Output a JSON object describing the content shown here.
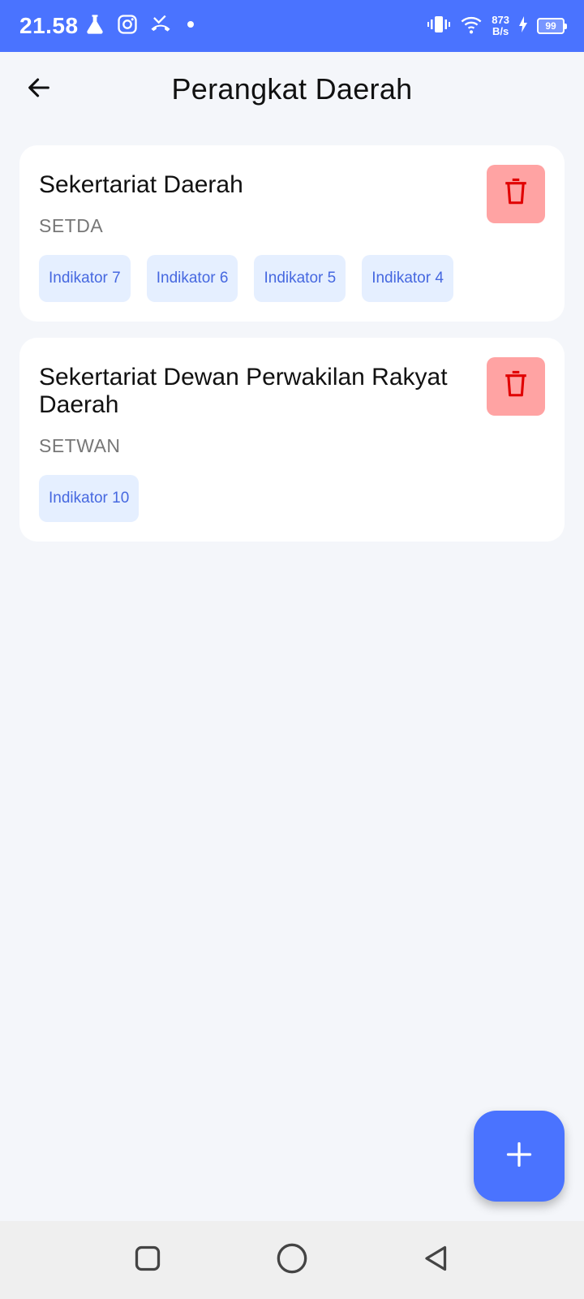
{
  "status_bar": {
    "time": "21.58",
    "net_speed_value": "873",
    "net_speed_unit": "B/s",
    "battery": "99",
    "icons": [
      "flask-icon",
      "instagram-icon",
      "missed-call-icon",
      "dot-icon",
      "vibrate-icon",
      "wifi-icon",
      "charging-icon",
      "battery-icon"
    ]
  },
  "app_bar": {
    "title": "Perangkat Daerah",
    "back_icon": "arrow-left-icon"
  },
  "items": [
    {
      "name": "Sekertariat Daerah",
      "code": "SETDA",
      "indicators": [
        "Indikator 7",
        "Indikator 6",
        "Indikator 5",
        "Indikator 4"
      ]
    },
    {
      "name": "Sekertariat Dewan Perwakilan Rakyat Daerah",
      "code": "SETWAN",
      "indicators": [
        "Indikator 10"
      ]
    }
  ],
  "fab": {
    "icon": "plus-icon"
  },
  "nav_bar": {
    "icons": [
      "recents-square-icon",
      "home-circle-icon",
      "back-triangle-icon"
    ]
  },
  "colors": {
    "primary": "#4a73ff",
    "background": "#f4f6fa",
    "card": "#ffffff",
    "chip_bg": "#e5efff",
    "chip_text": "#4668e0",
    "delete_bg": "#ffa3a3",
    "delete_icon": "#e00000"
  }
}
